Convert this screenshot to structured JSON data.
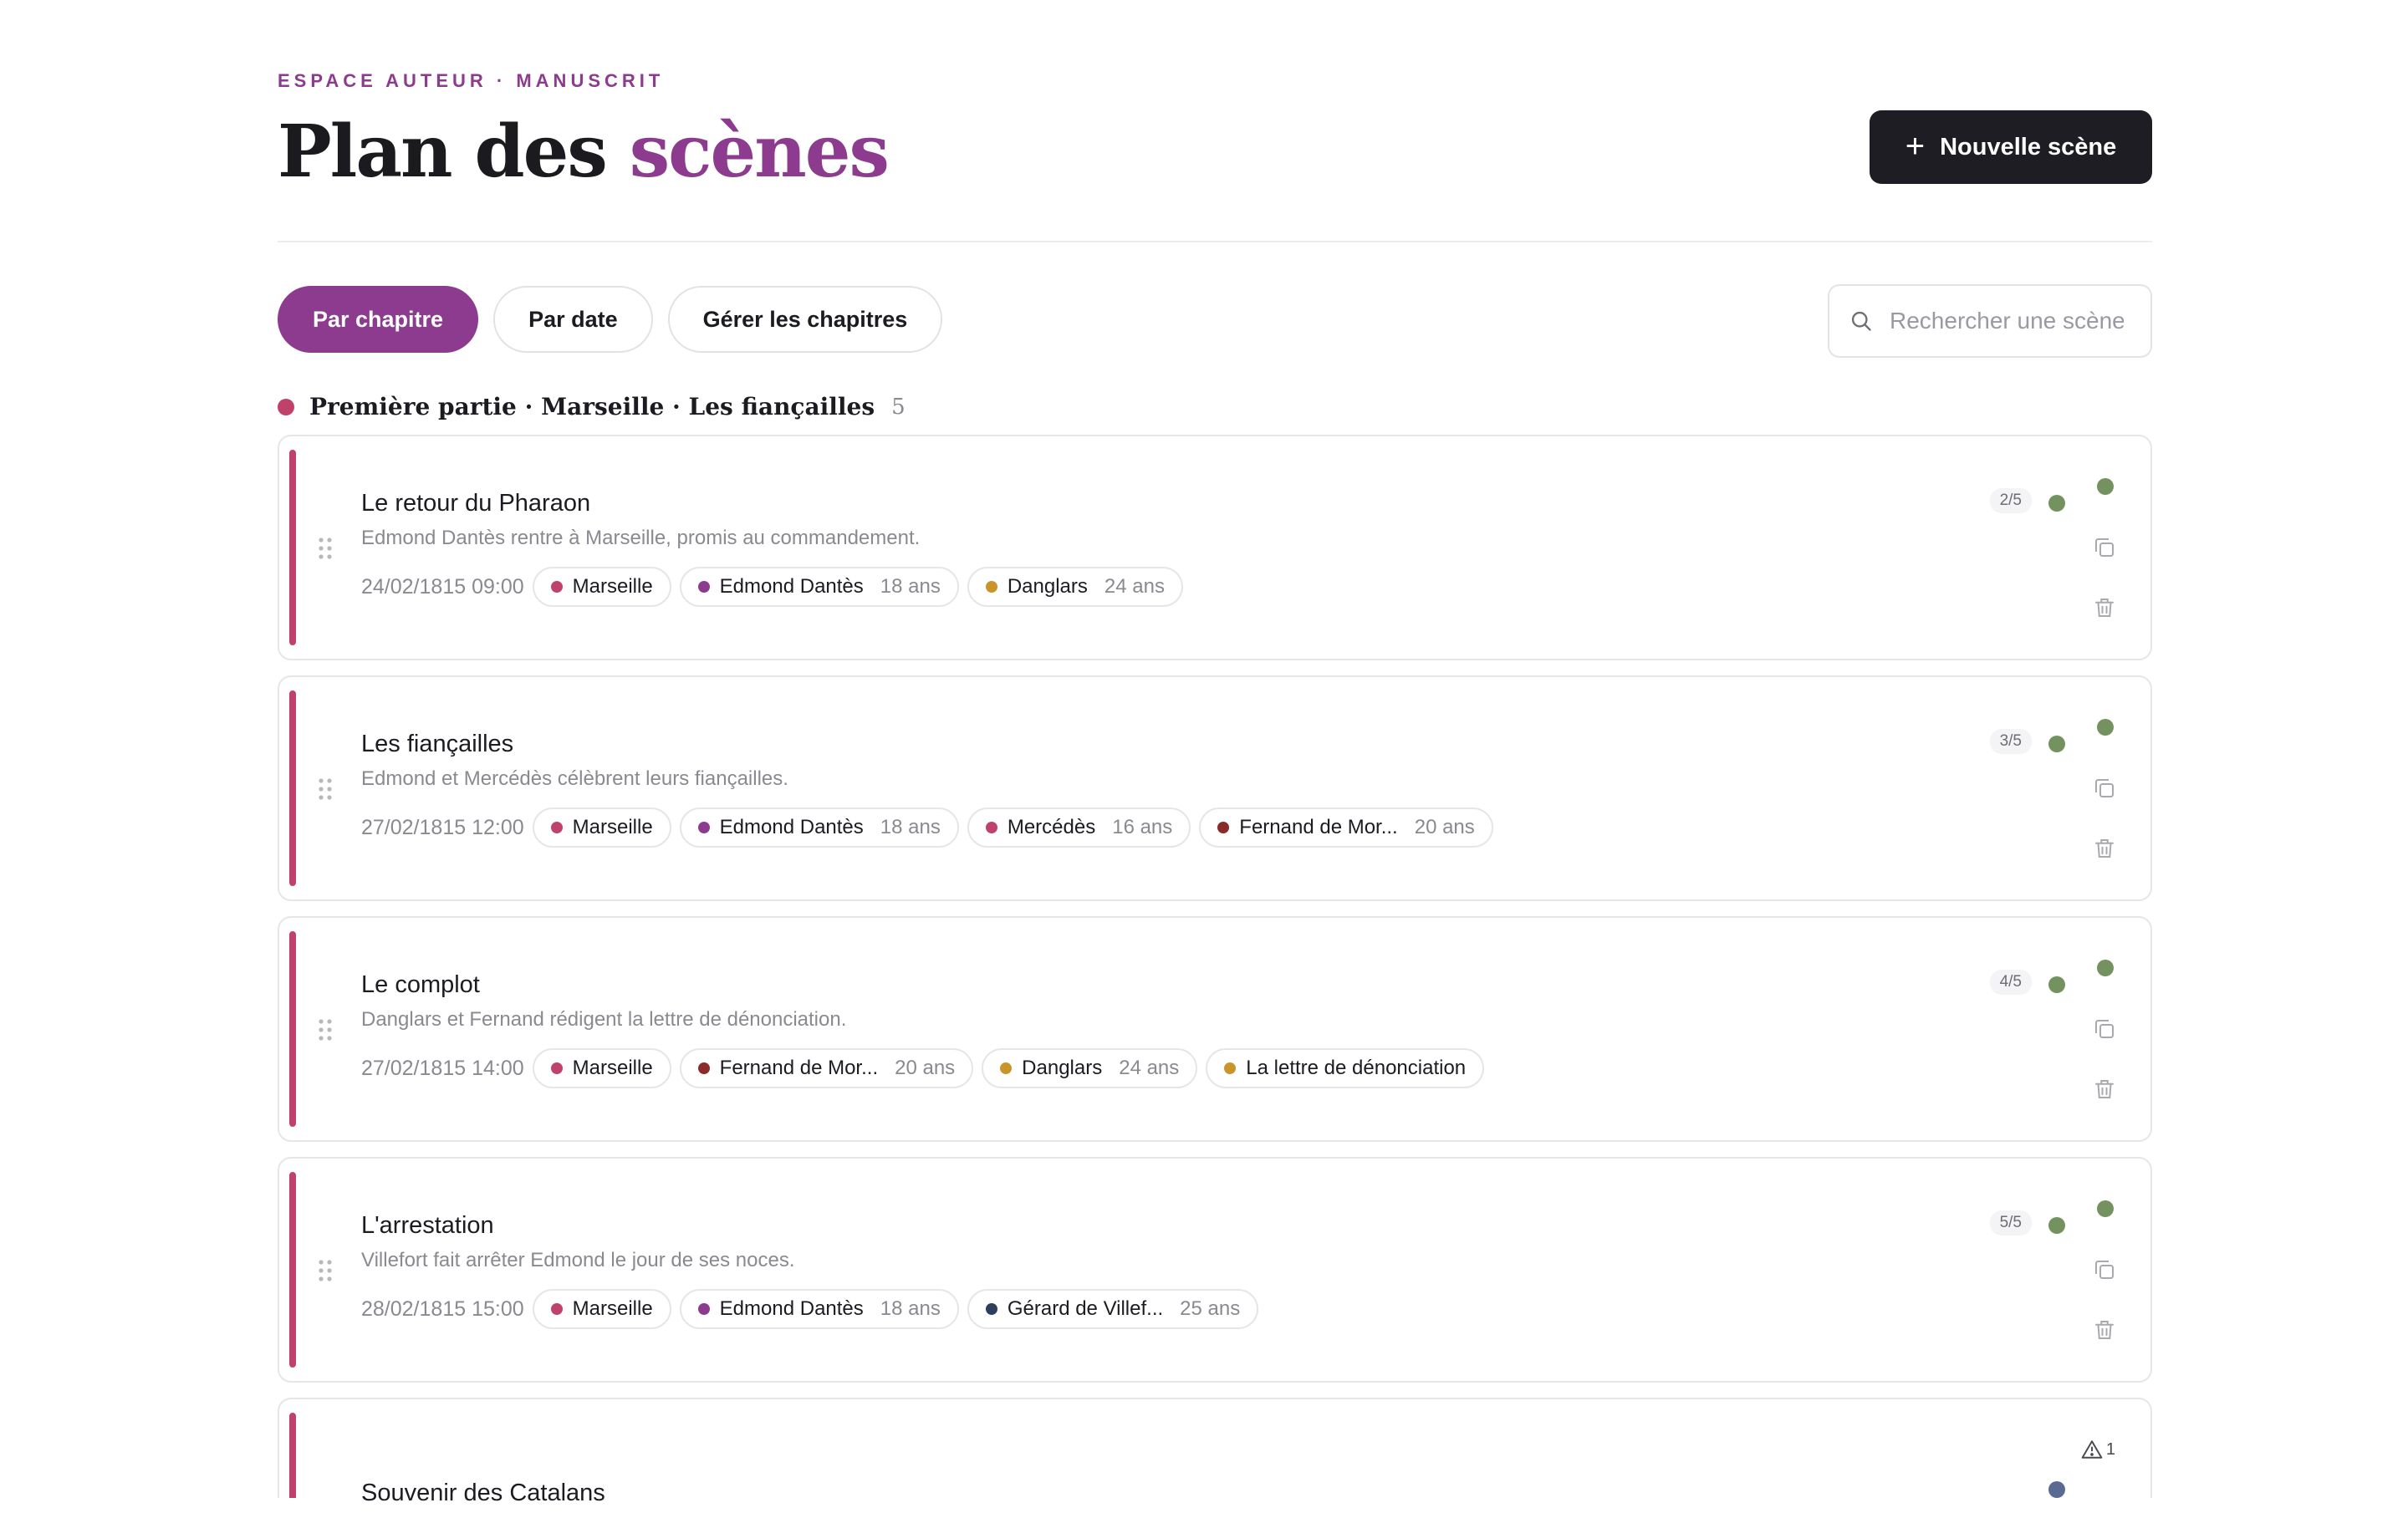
{
  "header": {
    "eyebrow": "ESPACE AUTEUR · MANUSCRIT",
    "title_main": "Plan des",
    "title_accent": "scènes",
    "new_scene_label": "Nouvelle scène"
  },
  "filters": {
    "tabs": [
      {
        "label": "Par chapitre",
        "active": true
      },
      {
        "label": "Par date",
        "active": false
      },
      {
        "label": "Gérer les chapitres",
        "active": false
      }
    ],
    "search_placeholder": "Rechercher une scène"
  },
  "chapter": {
    "name": "Première partie · Marseille · Les fiançailles",
    "count": "5",
    "color": "#c0416a"
  },
  "scenes": [
    {
      "title": "Le retour du Pharaon",
      "description": "Edmond Dantès rentre à Marseille, promis au commandement.",
      "datetime": "24/02/1815 09:00",
      "progress": "2/5",
      "chips": [
        {
          "label": "Marseille",
          "age": "",
          "color": "#c0416a"
        },
        {
          "label": "Edmond Dantès",
          "age": "18 ans",
          "color": "#8d3b8f"
        },
        {
          "label": "Danglars",
          "age": "24 ans",
          "color": "#c9952a"
        }
      ]
    },
    {
      "title": "Les fiançailles",
      "description": "Edmond et Mercédès célèbrent leurs fiançailles.",
      "datetime": "27/02/1815 12:00",
      "progress": "3/5",
      "chips": [
        {
          "label": "Marseille",
          "age": "",
          "color": "#c0416a"
        },
        {
          "label": "Edmond Dantès",
          "age": "18 ans",
          "color": "#8d3b8f"
        },
        {
          "label": "Mercédès",
          "age": "16 ans",
          "color": "#c0416a"
        },
        {
          "label": "Fernand de Mor...",
          "age": "20 ans",
          "color": "#8a2a2a"
        }
      ]
    },
    {
      "title": "Le complot",
      "description": "Danglars et Fernand rédigent la lettre de dénonciation.",
      "datetime": "27/02/1815 14:00",
      "progress": "4/5",
      "chips": [
        {
          "label": "Marseille",
          "age": "",
          "color": "#c0416a"
        },
        {
          "label": "Fernand de Mor...",
          "age": "20 ans",
          "color": "#8a2a2a"
        },
        {
          "label": "Danglars",
          "age": "24 ans",
          "color": "#c9952a"
        },
        {
          "label": "La lettre de dénonciation",
          "age": "",
          "color": "#c9952a"
        }
      ]
    },
    {
      "title": "L'arrestation",
      "description": "Villefort fait arrêter Edmond le jour de ses noces.",
      "datetime": "28/02/1815 15:00",
      "progress": "5/5",
      "chips": [
        {
          "label": "Marseille",
          "age": "",
          "color": "#c0416a"
        },
        {
          "label": "Edmond Dantès",
          "age": "18 ans",
          "color": "#8d3b8f"
        },
        {
          "label": "Gérard de Villef...",
          "age": "25 ans",
          "color": "#2d3f5f"
        }
      ]
    },
    {
      "title": "Souvenir des Catalans",
      "warning_count": "1"
    }
  ],
  "colors": {
    "accent": "#8d3b8f",
    "chapter": "#c0416a",
    "status_done": "#74925f",
    "status_warning": "#5b6a92"
  }
}
